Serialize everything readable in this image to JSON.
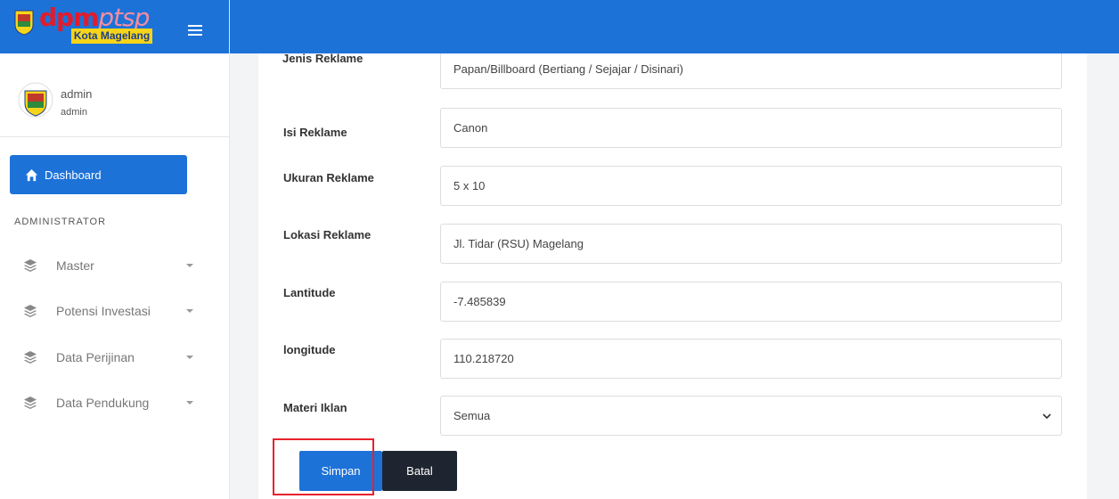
{
  "brand": {
    "logo_main": "dpm",
    "logo_accent": "ptsp",
    "logo_sub": "Kota Magelang",
    "menu_icon": "hamburger-icon"
  },
  "user": {
    "name": "admin",
    "role": "admin"
  },
  "sidebar": {
    "dashboard_label": "Dashboard",
    "section_label": "ADMINISTRATOR",
    "items": [
      {
        "label": "Master",
        "icon": "layers-icon"
      },
      {
        "label": "Potensi Investasi",
        "icon": "layers-icon"
      },
      {
        "label": "Data Perijinan",
        "icon": "layers-icon"
      },
      {
        "label": "Data Pendukung",
        "icon": "layers-icon"
      }
    ]
  },
  "form": {
    "partial_label": "Jenis Reklame",
    "partial_value": "Papan/Billboard (Bertiang / Sejajar / Disinari)",
    "fields": [
      {
        "label": "Isi Reklame",
        "value": "Canon"
      },
      {
        "label": "Ukuran Reklame",
        "value": "5 x 10"
      },
      {
        "label": "Lokasi Reklame",
        "value": "Jl. Tidar (RSU) Magelang"
      },
      {
        "label": "Lantitude",
        "value": "-7.485839"
      },
      {
        "label": "longitude",
        "value": "110.218720"
      }
    ],
    "materi": {
      "label": "Materi Iklan",
      "selected": "Semua"
    },
    "save_label": "Simpan",
    "cancel_label": "Batal"
  },
  "colors": {
    "primary": "#1d72d8",
    "dark_button": "#1f2530",
    "highlight": "#e8212b"
  }
}
